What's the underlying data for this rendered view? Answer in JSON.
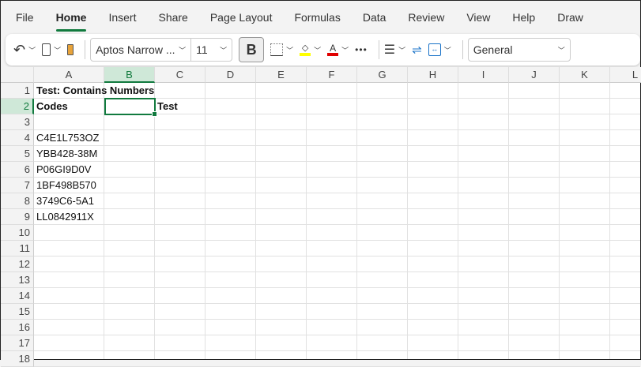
{
  "menu": [
    "File",
    "Home",
    "Insert",
    "Share",
    "Page Layout",
    "Formulas",
    "Data",
    "Review",
    "View",
    "Help",
    "Draw"
  ],
  "toolbar": {
    "font": "Aptos Narrow ...",
    "size": "11",
    "bold": "B",
    "more": "•••",
    "format": "General",
    "font_color_letter": "A",
    "highlight_color": "#ffff00",
    "font_color": "#e00000"
  },
  "columns": [
    "A",
    "B",
    "C",
    "D",
    "E",
    "F",
    "G",
    "H",
    "I",
    "J",
    "K",
    "L"
  ],
  "rows": [
    "1",
    "2",
    "3",
    "4",
    "5",
    "6",
    "7",
    "8",
    "9",
    "10",
    "11",
    "12",
    "13",
    "14",
    "15",
    "16",
    "17",
    "18"
  ],
  "cells": {
    "a1": "Test: Contains Numbers",
    "a2": "Codes",
    "c2": "Test",
    "codes": [
      "C4E1L753OZ",
      "YBB428-38M",
      "P06GI9D0V",
      "1BF498B570",
      "3749C6-5A1",
      "LL0842911X"
    ]
  }
}
